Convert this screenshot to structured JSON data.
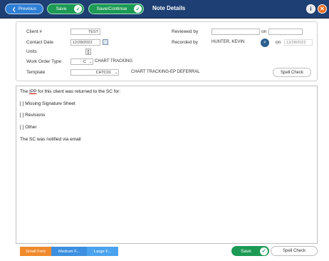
{
  "toolbar": {
    "previous_label": "Previous",
    "save_label": "Save",
    "save_continue_label": "Save/Continue",
    "title": "Note Details"
  },
  "form": {
    "client_label": "Client #",
    "client_value": "TEST",
    "contact_date_label": "Contact Date",
    "contact_date_value": "12/28/2022",
    "units_label": "Units",
    "work_order_type_label": "Work Order Type",
    "work_order_type_value": "C",
    "work_order_type_text": "CHART TRACKING",
    "template_label": "Template",
    "template_value": "CHTC01",
    "template_text": "CHART TRACKING-EP DEFERRAL",
    "reviewed_by_label": "Reviewed by",
    "reviewed_by_value": "",
    "on_label": "on",
    "reviewed_on_value": "",
    "recorded_by_label": "Recorded by",
    "recorded_by_value": "HUNTER, KEVIN",
    "recorded_on_label": "on",
    "recorded_on_value": "12/28/2022",
    "spell_check_label": "Spell Check"
  },
  "note": {
    "line1_prefix": "The ",
    "line1_ipp": "IPP",
    "line1_suffix": " for this client was returned to the SC for:",
    "line2": "[ ] Missing Signature Sheet",
    "line3": "[ ] Revisions",
    "line4": "[ ] Other",
    "line5": "The SC was notified via email"
  },
  "bottom": {
    "small_font_label": "Small Font",
    "medium_font_label": "Medium F...",
    "large_font_label": "Large F...",
    "save_label": "Save",
    "spell_check_label": "Spell Check"
  }
}
